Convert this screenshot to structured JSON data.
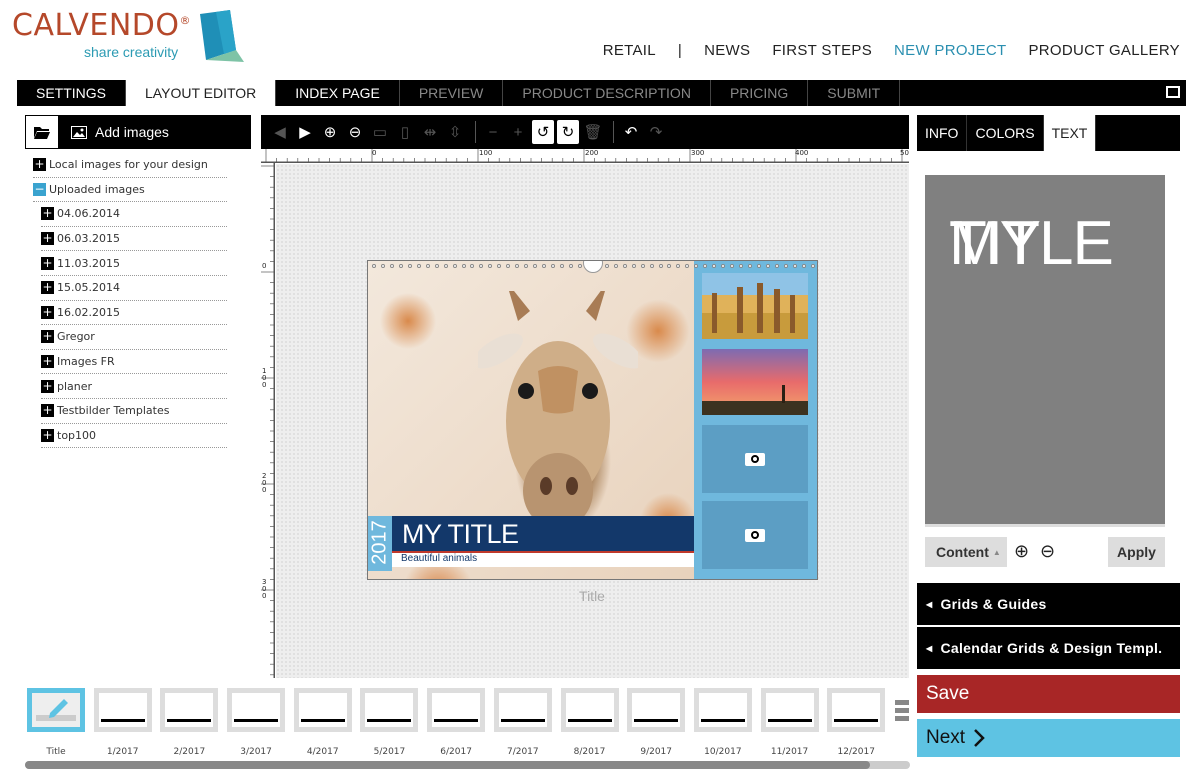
{
  "brand": {
    "name": "CALVENDO",
    "reg": "®",
    "tagline": "share creativity"
  },
  "topnav": [
    {
      "label": "RETAIL"
    },
    {
      "label": "|"
    },
    {
      "label": "NEWS"
    },
    {
      "label": "FIRST STEPS"
    },
    {
      "label": "NEW PROJECT"
    },
    {
      "label": "PRODUCT GALLERY"
    }
  ],
  "tabs": [
    {
      "label": "SETTINGS"
    },
    {
      "label": "LAYOUT EDITOR"
    },
    {
      "label": "INDEX PAGE"
    },
    {
      "label": "PREVIEW"
    },
    {
      "label": "PRODUCT DESCRIPTION"
    },
    {
      "label": "PRICING"
    },
    {
      "label": "SUBMIT"
    }
  ],
  "left_panel": {
    "add_images_label": "Add images",
    "local_images": "Local images for your design",
    "uploaded_images": "Uploaded images",
    "folders": [
      "04.06.2014",
      "06.03.2015",
      "11.03.2015",
      "15.05.2014",
      "16.02.2015",
      "Gregor",
      "Images FR",
      "planer",
      "Testbilder Templates",
      "top100"
    ]
  },
  "ruler": {
    "top_labels": [
      "0",
      "100",
      "200",
      "300",
      "400",
      "50"
    ],
    "left_labels": [
      "0",
      "100",
      "200",
      "300"
    ]
  },
  "calendar": {
    "year": "2017",
    "title": "MY TITLE",
    "subtitle": "Beautiful animals",
    "caption": "Title"
  },
  "right_panel": {
    "tabs": [
      "INFO",
      "COLORS",
      "TEXT"
    ],
    "preview_text_line1": "MY",
    "preview_text_line2": "TITLE",
    "content_label": "Content",
    "content_caret": "▲",
    "apply_label": "Apply",
    "grids_label": "Grids & Guides",
    "calendar_grids_label": "Calendar Grids & Design Templ.",
    "save_label": "Save",
    "next_label": "Next"
  },
  "thumbnails": [
    "Title",
    "1/2017",
    "2/2017",
    "3/2017",
    "4/2017",
    "5/2017",
    "6/2017",
    "7/2017",
    "8/2017",
    "9/2017",
    "10/2017",
    "11/2017",
    "12/2017"
  ],
  "colors": {
    "accent": "#2a8fb0",
    "save": "#a82626",
    "next": "#5ec3e3",
    "title_band": "#13386a",
    "side": "#6fb8dd"
  }
}
